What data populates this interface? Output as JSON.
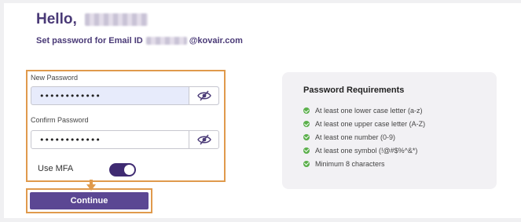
{
  "greeting": "Hello,",
  "subtitle_prefix": "Set password for Email ID",
  "subtitle_email_domain": "@kovair.com",
  "form": {
    "new_password_label": "New Password",
    "new_password_value": "••••••••••••",
    "confirm_password_label": "Confirm Password",
    "confirm_password_value": "••••••••••••",
    "mfa_label": "Use MFA",
    "mfa_enabled": true
  },
  "continue_label": "Continue",
  "requirements": {
    "title": "Password Requirements",
    "items": [
      "At least one lower case letter (a-z)",
      "At least one upper case letter (A-Z)",
      "At least one number (0-9)",
      "At least one symbol (!@#$%^&*)",
      "Minimum 8 characters"
    ],
    "check_color": "#5bb04b"
  },
  "colors": {
    "brand": "#4a3a77",
    "button": "#5b4793",
    "highlight": "#e09a4c",
    "toggle_on": "#3f2b72"
  }
}
